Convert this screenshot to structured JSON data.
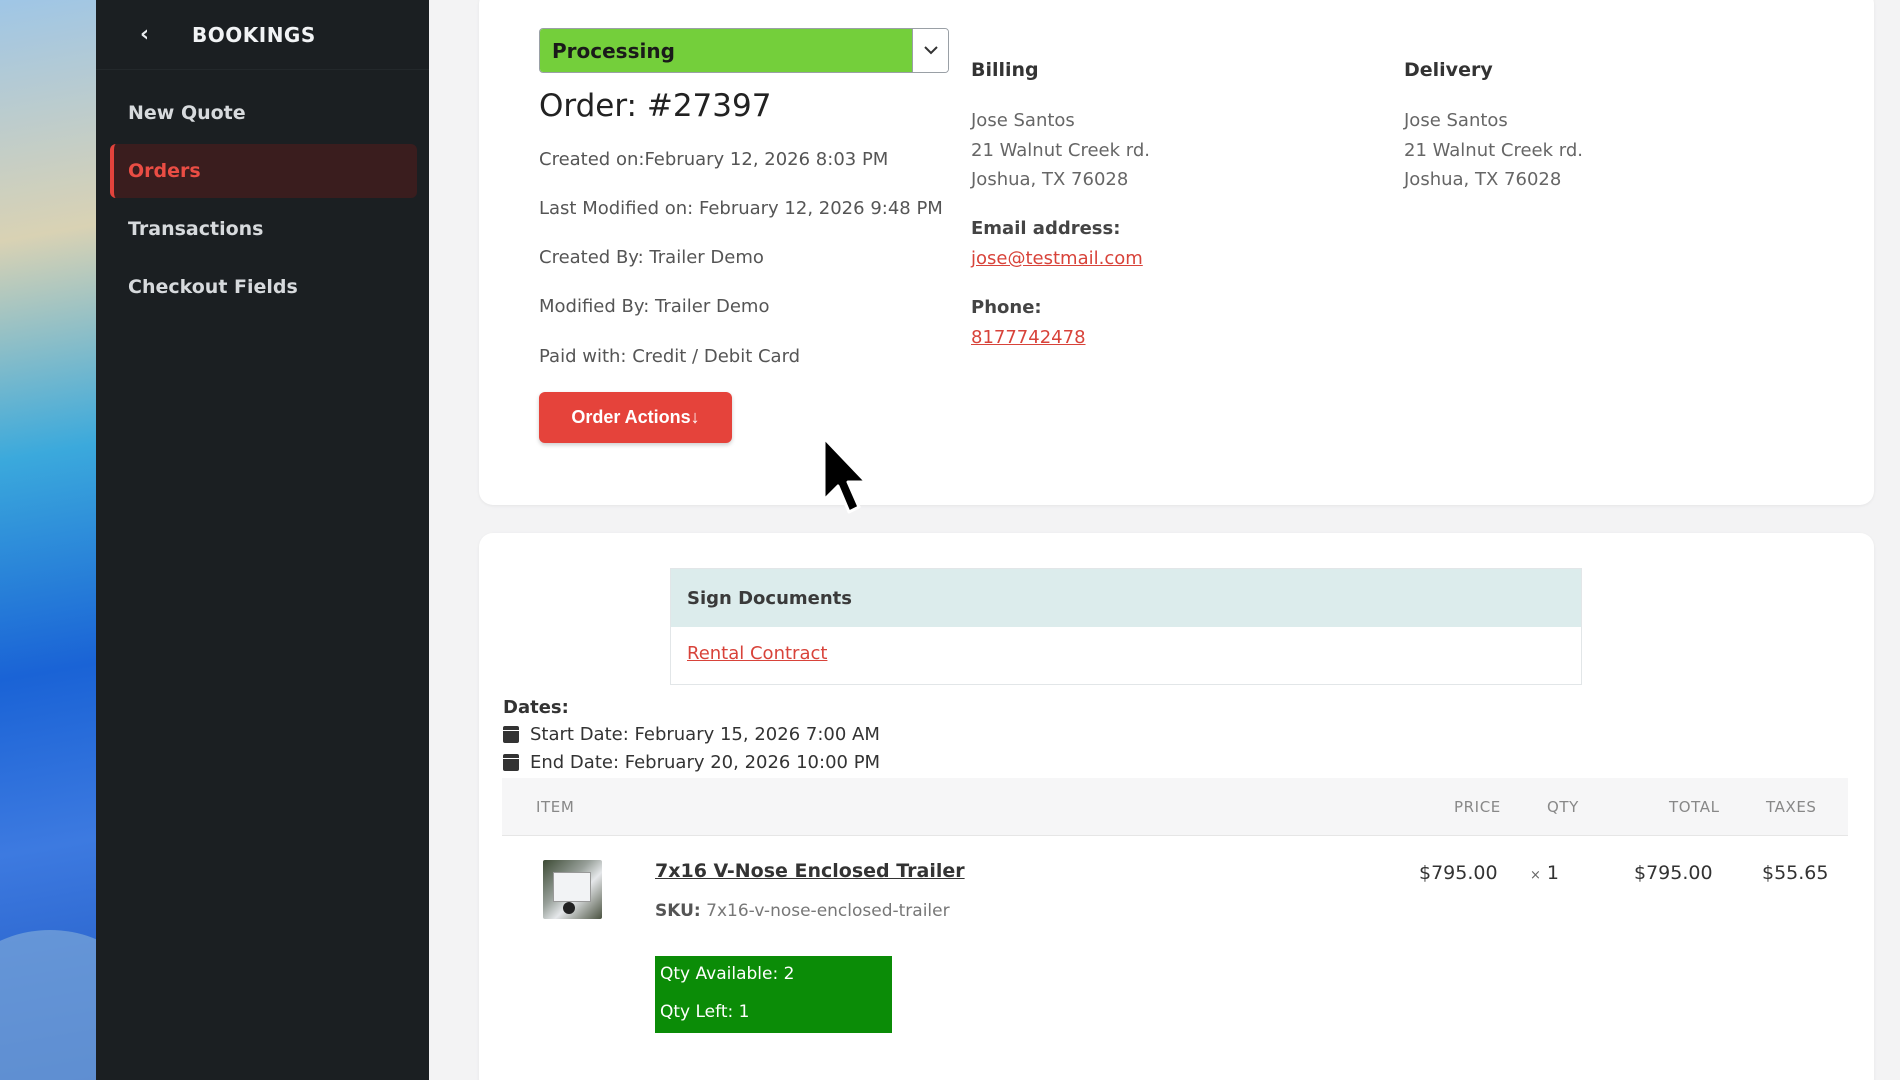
{
  "sidebar": {
    "back_icon": "chevron-left-icon",
    "title": "BOOKINGS",
    "items": [
      {
        "label": "New Quote",
        "active": false
      },
      {
        "label": "Orders",
        "active": true
      },
      {
        "label": "Transactions",
        "active": false
      },
      {
        "label": "Checkout Fields",
        "active": false
      }
    ]
  },
  "order": {
    "status": "Processing",
    "status_color": "#74cf3b",
    "title": "Order: #27397",
    "created_on": "Created on:February 12, 2026 8:03 PM",
    "last_modified": "Last Modified on: February 12, 2026 9:48 PM",
    "created_by": "Created By: Trailer Demo",
    "modified_by": "Modified By: Trailer Demo",
    "paid_with": "Paid with: Credit / Debit Card",
    "actions_button": "Order Actions↓"
  },
  "billing": {
    "heading": "Billing",
    "name": "Jose Santos",
    "street": "21 Walnut Creek rd.",
    "city": "Joshua, TX 76028",
    "email_label": "Email address:",
    "email": "jose@testmail.com",
    "phone_label": "Phone:",
    "phone": "8177742478"
  },
  "delivery": {
    "heading": "Delivery",
    "name": "Jose Santos",
    "street": "21 Walnut Creek rd.",
    "city": "Joshua, TX 76028"
  },
  "documents": {
    "heading": "Sign Documents",
    "link": "Rental Contract"
  },
  "dates": {
    "label": "Dates:",
    "start": "Start Date: February 15, 2026 7:00 AM",
    "end": "End Date: February 20, 2026 10:00 PM"
  },
  "table": {
    "headers": {
      "item": "ITEM",
      "price": "PRICE",
      "qty": "QTY",
      "total": "TOTAL",
      "taxes": "TAXES"
    },
    "rows": [
      {
        "name": "7x16 V-Nose Enclosed Trailer",
        "sku_label": "SKU:",
        "sku": "7x16-v-nose-enclosed-trailer",
        "price": "$795.00",
        "qty_prefix": "×",
        "qty": "1",
        "total": "$795.00",
        "taxes": "$55.65",
        "qty_available": "Qty Available: 2",
        "qty_left": "Qty Left: 1"
      }
    ]
  },
  "colors": {
    "accent": "#e5433b",
    "sidebar_bg": "#1b1f22",
    "stock_green": "#0b8c07",
    "doc_header": "#dcecec"
  }
}
